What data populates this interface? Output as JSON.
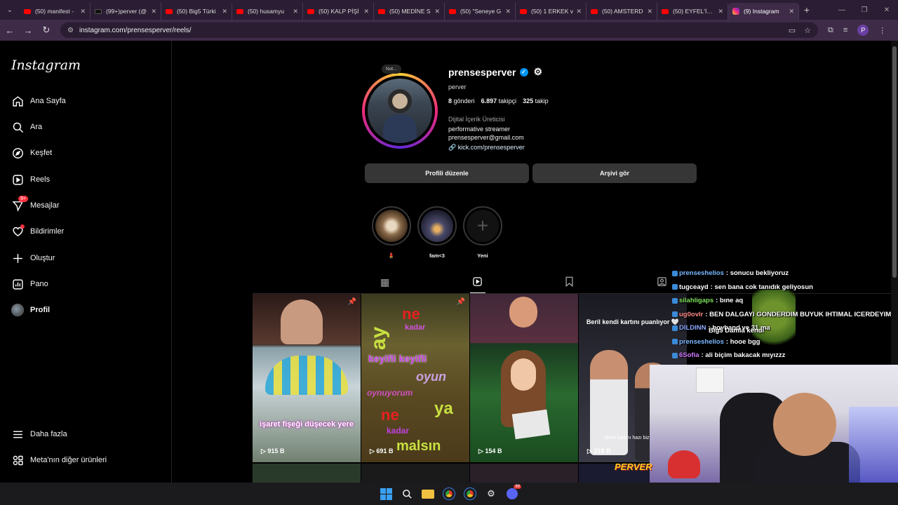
{
  "browser": {
    "tabs": [
      {
        "label": "(50) manifest -",
        "icon": "youtube-icon"
      },
      {
        "label": "(99+)perver (@",
        "icon": "tiktok-icon"
      },
      {
        "label": "(50) Big5 Türki",
        "icon": "youtube-icon"
      },
      {
        "label": "(50) husamyu",
        "icon": "youtube-icon"
      },
      {
        "label": "(50) KALP PİŞİ",
        "icon": "youtube-icon"
      },
      {
        "label": "(50) MEDİNE S",
        "icon": "youtube-icon"
      },
      {
        "label": "(50) \"Seneye G",
        "icon": "youtube-icon"
      },
      {
        "label": "(50) 1 ERKEK v",
        "icon": "youtube-icon"
      },
      {
        "label": "(50) AMSTERD",
        "icon": "youtube-icon"
      },
      {
        "label": "(50) EYFEL'İN A",
        "icon": "youtube-icon"
      },
      {
        "label": "(9) Instagram",
        "icon": "instagram-icon"
      }
    ],
    "url": "instagram.com/prensesperver/reels/"
  },
  "sidebar": {
    "logo": "Instagram",
    "items": [
      {
        "label": "Ana Sayfa",
        "icon": "home-icon"
      },
      {
        "label": "Ara",
        "icon": "search-icon"
      },
      {
        "label": "Keşfet",
        "icon": "compass-icon"
      },
      {
        "label": "Reels",
        "icon": "reels-icon"
      },
      {
        "label": "Mesajlar",
        "icon": "messenger-icon",
        "badge": "9+"
      },
      {
        "label": "Bildirimler",
        "icon": "heart-icon"
      },
      {
        "label": "Oluştur",
        "icon": "plus-icon"
      },
      {
        "label": "Pano",
        "icon": "dashboard-icon"
      },
      {
        "label": "Profil",
        "icon": "avatar"
      }
    ],
    "more": "Daha fazla",
    "meta": "Meta'nın diğer ürünleri"
  },
  "profile": {
    "note": "Not...",
    "username": "prensesperver",
    "full_name": "perver",
    "posts_count": "8",
    "posts_label": "gönderi",
    "followers_count": "6.897",
    "followers_label": "takipçi",
    "following_count": "325",
    "following_label": "takip",
    "category": "Dijital İçerik Üreticisi",
    "bio_line1": "performative streamer",
    "bio_line2": "prensesperver@gmail.com",
    "link": "kick.com/prensesperver",
    "edit_button": "Profili düzenle",
    "archive_button": "Arşivi gör"
  },
  "highlights": [
    {
      "label": "💄"
    },
    {
      "label": "fam<3"
    },
    {
      "label": "Yeni"
    }
  ],
  "reels": [
    {
      "views": "915 B",
      "caption": "işaret fişeği düşecek yere",
      "pinned": true
    },
    {
      "views": "691 B",
      "pinned": true,
      "words": [
        "ay",
        "ne",
        "kadar",
        "keyifli keyifli",
        "oyun",
        "oynuyorum",
        "ne",
        "kadar",
        "ya",
        "malsın"
      ]
    },
    {
      "views": "154 B",
      "pinned": false
    },
    {
      "views": "218 B",
      "pinned": false,
      "caption_top": "Beril kendi kartını puanlıyor 🤍",
      "caption_bottom": "senin kartını hazı biz sana"
    }
  ],
  "stream_overlay": {
    "chat": [
      {
        "user": "prenseshelios",
        "msg": ": sonucu bekliyoruz",
        "color": "#7ab8ff"
      },
      {
        "user": "tugceayd",
        "msg": ": sen bana cok tanıdık geliyosun",
        "color": "#ffffff"
      },
      {
        "user": "silahligaps",
        "msg": ": bıne aq",
        "color": "#7ee05a"
      },
      {
        "user": "ug0ovlr",
        "msg": ": BEN DALGAYI GONDERDIM BUYUK IHTIMAL ICERDEYIM",
        "color": "#ff8a8a"
      },
      {
        "user": "DILDINN",
        "msg": ": boyband ve 31 ma",
        "color": "#8aa8ff"
      },
      {
        "user": "prenseshelios",
        "msg": ": hooe bgg",
        "color": "#7ab8ff"
      },
      {
        "user": "6Sofia",
        "msg": ": ali biçim bakacak mıyızzz",
        "color": "#d07aff"
      }
    ],
    "game_title": "Big5 Damla kendi",
    "logo": "PERVER"
  }
}
